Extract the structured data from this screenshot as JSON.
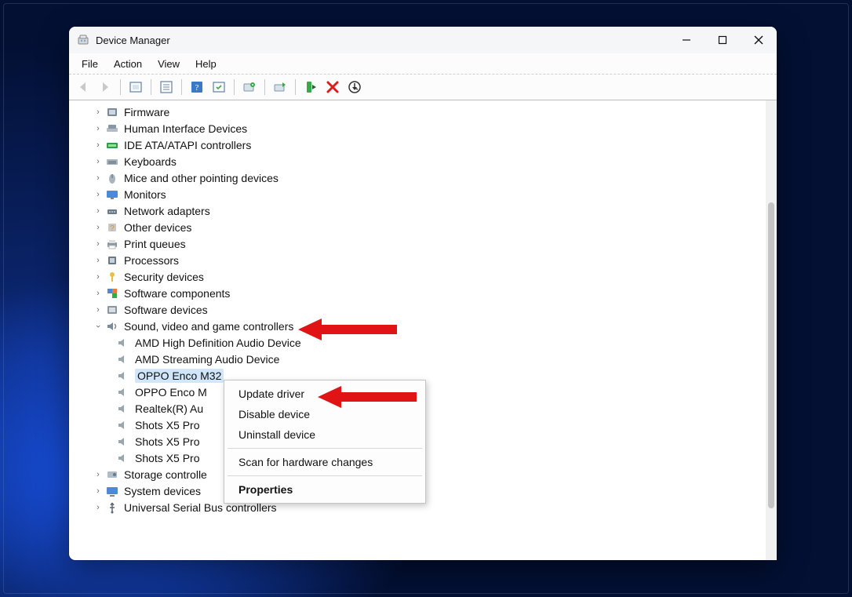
{
  "window": {
    "title": "Device Manager"
  },
  "menu": {
    "file": "File",
    "action": "Action",
    "view": "View",
    "help": "Help"
  },
  "tree": {
    "categories": [
      {
        "label": "Firmware"
      },
      {
        "label": "Human Interface Devices"
      },
      {
        "label": "IDE ATA/ATAPI controllers"
      },
      {
        "label": "Keyboards"
      },
      {
        "label": "Mice and other pointing devices"
      },
      {
        "label": "Monitors"
      },
      {
        "label": "Network adapters"
      },
      {
        "label": "Other devices"
      },
      {
        "label": "Print queues"
      },
      {
        "label": "Processors"
      },
      {
        "label": "Security devices"
      },
      {
        "label": "Software components"
      },
      {
        "label": "Software devices"
      }
    ],
    "expanded_category": {
      "label": "Sound, video and game controllers"
    },
    "children": [
      {
        "label": "AMD High Definition Audio Device"
      },
      {
        "label": "AMD Streaming Audio Device"
      },
      {
        "label": "OPPO Enco M32",
        "selected": true
      },
      {
        "label": "OPPO Enco M"
      },
      {
        "label": "Realtek(R) Au"
      },
      {
        "label": "Shots X5 Pro"
      },
      {
        "label": "Shots X5 Pro"
      },
      {
        "label": "Shots X5 Pro"
      }
    ],
    "after": [
      {
        "label": "Storage controlle"
      },
      {
        "label": "System devices"
      },
      {
        "label": "Universal Serial Bus controllers"
      }
    ]
  },
  "context_menu": {
    "update": "Update driver",
    "disable": "Disable device",
    "uninstall": "Uninstall device",
    "scan": "Scan for hardware changes",
    "properties": "Properties"
  }
}
